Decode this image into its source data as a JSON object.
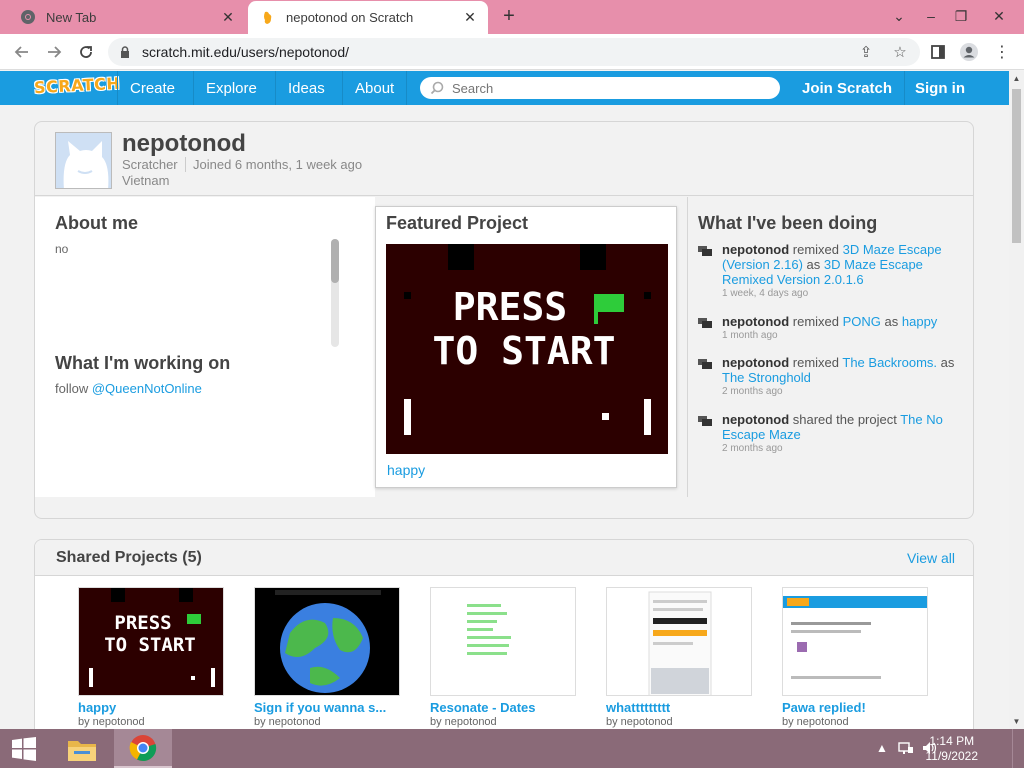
{
  "browser": {
    "tabs": [
      {
        "title": "New Tab"
      },
      {
        "title": "nepotonod on Scratch"
      }
    ],
    "url": "scratch.mit.edu/users/nepotonod/"
  },
  "scratch_nav": {
    "logo": "SCRATCH",
    "links": [
      "Create",
      "Explore",
      "Ideas",
      "About"
    ],
    "search_placeholder": "Search",
    "join": "Join Scratch",
    "signin": "Sign in"
  },
  "profile": {
    "username": "nepotonod",
    "role": "Scratcher",
    "joined": "Joined 6 months, 1 week ago",
    "country": "Vietnam",
    "about_title": "About me",
    "about_text": "no",
    "working_title": "What I'm working on",
    "working_prefix": "follow ",
    "working_link": "@QueenNotOnline",
    "featured_title": "Featured Project",
    "featured_name": "happy",
    "featured_screen_text": [
      "PRESS",
      "TO START"
    ]
  },
  "activity": {
    "title": "What I've been doing",
    "items": [
      {
        "user": "nepotonod",
        "verb": " remixed ",
        "target": "3D Maze Escape (Version 2.16)",
        "mid": " as ",
        "result": "3D Maze Escape Remixed Version 2.0.1.6",
        "time": "1 week, 4 days ago"
      },
      {
        "user": "nepotonod",
        "verb": " remixed ",
        "target": "PONG",
        "mid": " as ",
        "result": "happy",
        "time": "1 month ago"
      },
      {
        "user": "nepotonod",
        "verb": " remixed ",
        "target": "The Backrooms.",
        "mid": " as ",
        "result": "The Stronghold",
        "time": "2 months ago"
      },
      {
        "user": "nepotonod",
        "verb": " shared the project ",
        "target": "The No Escape Maze",
        "mid": "",
        "result": "",
        "time": "2 months ago"
      }
    ]
  },
  "shared_projects": {
    "title": "Shared Projects (5)",
    "view_all": "View all",
    "items": [
      {
        "title": "happy",
        "by": "by nepotonod"
      },
      {
        "title": "Sign if you wanna s...",
        "by": "by nepotonod"
      },
      {
        "title": "Resonate - Dates",
        "by": "by nepotonod"
      },
      {
        "title": "whattttttttt",
        "by": "by nepotonod"
      },
      {
        "title": "Pawa replied!",
        "by": "by nepotonod"
      }
    ]
  },
  "taskbar": {
    "time": "1:14 PM",
    "date": "11/9/2022"
  },
  "colors": {
    "tabstrip": "#e78fab",
    "scratch_blue": "#1a9ce0",
    "taskbar": "#8a6a78",
    "project_bg": "#2c0000"
  }
}
